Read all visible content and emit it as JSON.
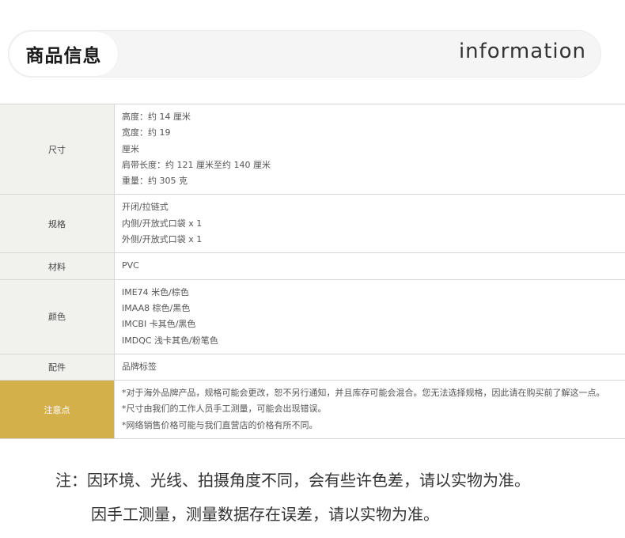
{
  "header": {
    "title_cn": "商品信息",
    "title_en": "information"
  },
  "specs": [
    {
      "label": "尺寸",
      "lines": [
        "高度：约 14 厘米",
        "宽度：约 19",
        "厘米",
        "肩带长度：约 121 厘米至约 140 厘米",
        "重量：约 305 克"
      ]
    },
    {
      "label": "规格",
      "lines": [
        "开闭/拉链式",
        "内侧/开放式口袋 x 1",
        "外侧/开放式口袋 x 1"
      ]
    },
    {
      "label": "材料",
      "lines": [
        "PVC"
      ]
    },
    {
      "label": "颜色",
      "lines": [
        "IME74 米色/棕色",
        "IMAA8 棕色/黑色",
        "IMCBI 卡其色/黑色",
        "IMDQC 浅卡其色/粉笔色"
      ]
    },
    {
      "label": "配件",
      "lines": [
        "品牌标签"
      ]
    },
    {
      "label": "注意点",
      "lines": [
        "*对于海外品牌产品，规格可能会更改，恕不另行通知，并且库存可能会混合。您无法选择规格，因此请在购买前了解这一点。",
        "*尺寸由我们的工作人员手工测量，可能会出现错误。",
        "*网络销售价格可能与我们直营店的价格有所不同。"
      ]
    }
  ],
  "notes": {
    "line1": "注：因环境、光线、拍摄角度不同，会有些许色差，请以实物为准。",
    "line2": "因手工测量，测量数据存在误差，请以实物为准。"
  },
  "colors": {
    "notice_label_bg": "#d3b04a",
    "label_bg": "#f1f1ee"
  }
}
